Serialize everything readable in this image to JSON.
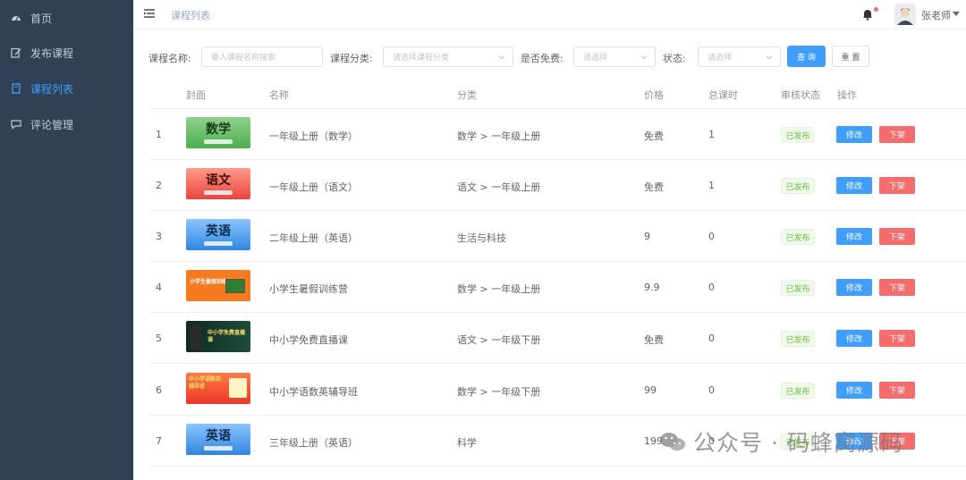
{
  "sidebar": {
    "items": [
      {
        "label": "首页",
        "icon": "dashboard-icon",
        "active": false
      },
      {
        "label": "发布课程",
        "icon": "edit-icon",
        "active": false
      },
      {
        "label": "课程列表",
        "icon": "document-icon",
        "active": true
      },
      {
        "label": "评论管理",
        "icon": "comment-icon",
        "active": false
      }
    ],
    "bg_color": "#304156",
    "active_color": "#409eff"
  },
  "header": {
    "breadcrumb": "课程列表",
    "user_name": "张老师"
  },
  "search": {
    "name_label": "课程名称:",
    "name_placeholder": "输入课程名称搜索",
    "category_label": "课程分类:",
    "category_placeholder": "请选择课程分类",
    "free_label": "是否免费:",
    "free_placeholder": "请选择",
    "status_label": "状态:",
    "status_placeholder": "请选择",
    "search_button": "查 询",
    "reset_button": "重 置"
  },
  "table": {
    "columns": {
      "cover": "封面",
      "name": "名称",
      "category": "分类",
      "price": "价格",
      "lessons": "总课时",
      "review_status": "审核状态",
      "actions": "操作"
    },
    "edit_label": "修改",
    "offline_label": "下架",
    "rows": [
      {
        "index": "1",
        "cover_text": "数学",
        "name": "一年级上册（数学）",
        "category": "数学 > 一年级上册",
        "price": "免费",
        "lessons": "1",
        "status": "已发布"
      },
      {
        "index": "2",
        "cover_text": "语文",
        "name": "一年级上册（语文）",
        "category": "语文 > 一年级上册",
        "price": "免费",
        "lessons": "1",
        "status": "已发布"
      },
      {
        "index": "3",
        "cover_text": "英语",
        "name": "二年级上册（英语）",
        "category": "生活与科技",
        "price": "9",
        "lessons": "0",
        "status": "已发布"
      },
      {
        "index": "4",
        "cover_text": "小学生暑假训练营",
        "name": "小学生暑假训练营",
        "category": "数学 > 一年级上册",
        "price": "9.9",
        "lessons": "0",
        "status": "已发布"
      },
      {
        "index": "5",
        "cover_text": "中小学免费直播课",
        "name": "中小学免费直播课",
        "category": "语文 > 一年级下册",
        "price": "免费",
        "lessons": "0",
        "status": "已发布"
      },
      {
        "index": "6",
        "cover_text": "中小学语数英辅导班",
        "name": "中小学语数英辅导班",
        "category": "数学 > 一年级下册",
        "price": "99",
        "lessons": "0",
        "status": "已发布"
      },
      {
        "index": "7",
        "cover_text": "英语",
        "name": "三年级上册（英语）",
        "category": "科学",
        "price": "199",
        "lessons": "0",
        "status": "已发布"
      }
    ]
  },
  "watermark": {
    "text": "公众号 · 码蜂窝源码"
  }
}
